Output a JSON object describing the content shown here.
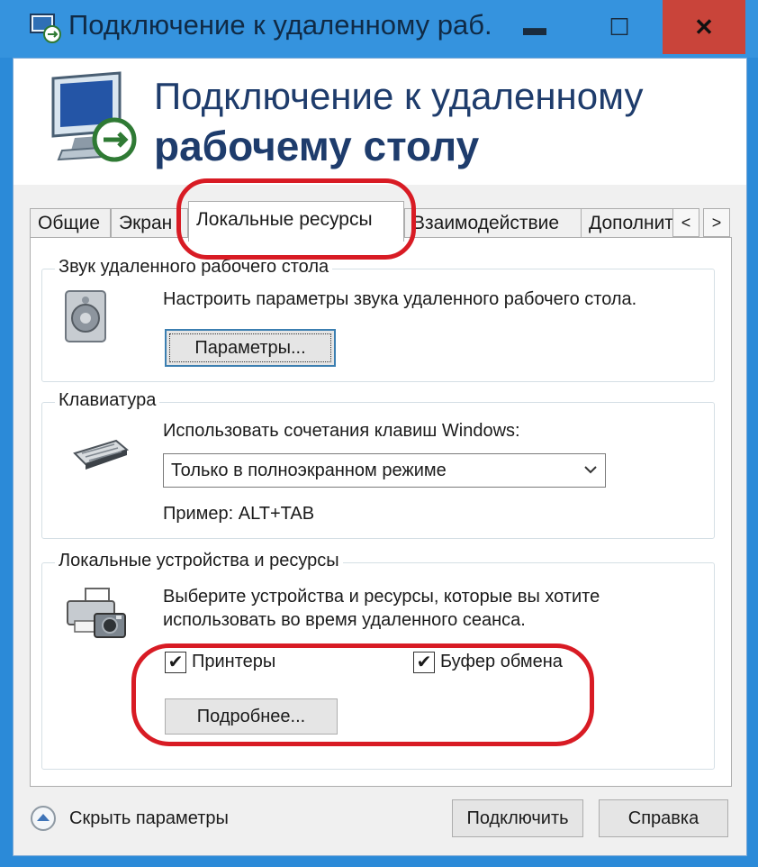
{
  "window": {
    "title": "Подключение к удаленному раб...",
    "controls": {
      "minimize": "▬",
      "maximize": "☐",
      "close": "✕"
    }
  },
  "banner": {
    "line1": "Подключение к удаленному",
    "line2": "рабочему столу"
  },
  "tabs": [
    {
      "label": "Общие"
    },
    {
      "label": "Экран"
    },
    {
      "label": "Локальные ресурсы",
      "active": true
    },
    {
      "label": "Взаимодействие"
    },
    {
      "label": "Дополнит"
    }
  ],
  "tab_nav": {
    "prev": "<",
    "next": ">"
  },
  "audio": {
    "legend": "Звук удаленного рабочего стола",
    "description": "Настроить параметры звука удаленного рабочего стола.",
    "button": "Параметры..."
  },
  "keyboard": {
    "legend": "Клавиатура",
    "label": "Использовать сочетания клавиш Windows:",
    "selected": "Только в полноэкранном режиме",
    "example": "Пример: ALT+TAB"
  },
  "devices": {
    "legend": "Локальные устройства и ресурсы",
    "description_line1": "Выберите устройства и ресурсы, которые вы хотите",
    "description_line2": "использовать во время удаленного сеанса.",
    "printers_label": "Принтеры",
    "printers_checked": true,
    "clipboard_label": "Буфер обмена",
    "clipboard_checked": true,
    "more_button": "Подробнее..."
  },
  "footer": {
    "hide_options": "Скрыть параметры",
    "connect": "Подключить",
    "help": "Справка"
  },
  "colors": {
    "titlebar": "#3593de",
    "close": "#c9443a",
    "highlight": "#d81b24",
    "heading": "#1e3c6c"
  }
}
